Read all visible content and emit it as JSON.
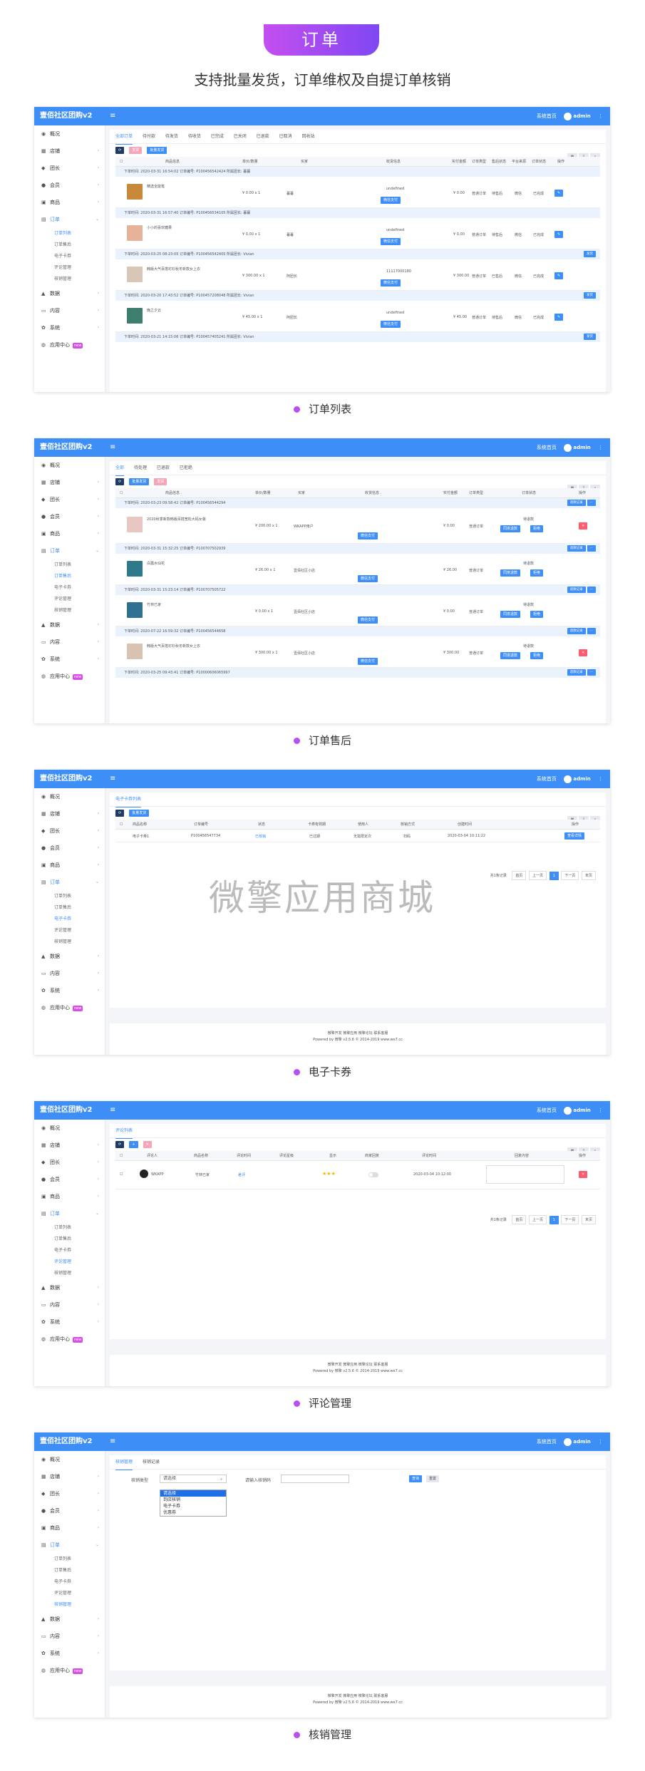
{
  "hero": {
    "badge": "订单",
    "subtitle": "支持批量发货，订单维权及自提订单核销"
  },
  "app": {
    "brand": "壹佰社区团购v2",
    "hamburger": "≡",
    "home_label": "系统首页",
    "user": "admin",
    "more": "⋮"
  },
  "sidebar": {
    "items": [
      {
        "icon": "◉",
        "label": "概况"
      },
      {
        "icon": "▦",
        "label": "店铺"
      },
      {
        "icon": "◆",
        "label": "团长"
      },
      {
        "icon": "●",
        "label": "会员"
      },
      {
        "icon": "▣",
        "label": "商品"
      },
      {
        "icon": "▤",
        "label": "订单"
      },
      {
        "icon": "▲",
        "label": "数据"
      },
      {
        "icon": "▭",
        "label": "内容"
      },
      {
        "icon": "✿",
        "label": "系统"
      },
      {
        "icon": "◍",
        "label": "应用中心",
        "tag": "new"
      }
    ],
    "sub": [
      "订单列表",
      "订单售后",
      "电子卡券",
      "评论管理",
      "核销管理"
    ]
  },
  "screens": {
    "orders": {
      "caption": "订单列表",
      "tabs": [
        "全部订单",
        "待付款",
        "待发货",
        "待收货",
        "已完成",
        "已关闭",
        "已退款",
        "已取消",
        "回收站"
      ],
      "buttons": [
        "发货",
        "批量发货"
      ],
      "headers": [
        "商品信息",
        "单价/数量",
        "买家",
        "收货信息",
        "实付金额",
        "订单类型",
        "售后状态",
        "平台来源",
        "订单状态",
        "操作"
      ],
      "groups": [
        {
          "head": "下单时间: 2020-03-31 16:54:02  订单编号: P100456542424  所属团长: 暮暮",
          "name": "精选全能笔",
          "price": "¥ 0.00 x 1",
          "buyer": "暮暮",
          "recv": "undefined",
          "amount": "¥ 0.00",
          "type": "普通订单",
          "after": "待售后",
          "src": "微信",
          "status": "已完成",
          "pay": "微信支付"
        },
        {
          "head": "下单时间: 2020-03-31 16:57:40  订单编号: P100456534105  所属团长: 暮暮",
          "name": "小小的喜欢糖果",
          "price": "¥ 0.00 x 1",
          "buyer": "暮暮",
          "recv": "undefined",
          "amount": "¥ 0.00",
          "type": "普通订单",
          "after": "待售后",
          "src": "微信",
          "status": "已完成",
          "pay": "微信支付"
        },
        {
          "head": "下单时间: 2020-03-25 08:23:05  订单编号: P100456542405  所属团长: Vivian",
          "name": "韩版大气百搭衬衫秋冬新款女上衣",
          "price": "¥ 300.00 x 1",
          "buyer": "阿团长",
          "recv": "11117000180",
          "amount": "¥ 300.00",
          "type": "普通订单",
          "after": "已售后",
          "src": "微信",
          "status": "已完成",
          "pay": "微信支付"
        },
        {
          "head": "下单时间: 2020-03-20 17:43:52  订单编号: P100457208048  所属团长: Vivian",
          "name": "晚之夕云",
          "price": "¥ 45.00 x 1",
          "buyer": "阿团长",
          "recv": "undefined",
          "amount": "¥ 45.00",
          "type": "普通订单",
          "after": "待售后",
          "src": "微信",
          "status": "已完成",
          "pay": "微信支付"
        }
      ],
      "last_head": "下单时间: 2020-03-21 14:15:06  订单编号: P100457405241  所属团长: Vivian"
    },
    "aftersale": {
      "caption": "订单售后",
      "tabs": [
        "全部",
        "待处理",
        "已退款",
        "已拒绝"
      ],
      "headers": [
        "商品信息",
        "单价/数量",
        "买家",
        "收货信息",
        "实付金额",
        "订单类型",
        "订单状态",
        "操作"
      ],
      "groups": [
        {
          "head": "下单时间: 2020-03-23 09:58:42  订单编号: P100456544294",
          "name": "2020秋季新款韩版百搭宽松大码女装",
          "price": "¥ 200.00 x 1",
          "buyer": "WKAPP用户",
          "amount": "¥ 0.00",
          "type": "普通订单",
          "status": "待退款"
        },
        {
          "head": "下单时间: 2020-03-31 15:32:25  订单编号: P100707502939",
          "name": "白露水仙花",
          "price": "¥ 26.00 x 1",
          "buyer": "壹佰社区小店",
          "amount": "¥ 26.00",
          "type": "普通订单",
          "status": "待退款"
        },
        {
          "head": "下单时间: 2020-03-31 15:23:14  订单编号: P100707505722",
          "name": "竹林已家",
          "price": "¥ 0.00 x 1",
          "buyer": "壹佰社区小店",
          "amount": "¥ 0.00",
          "type": "普通订单",
          "status": "待退款"
        },
        {
          "head": "下单时间: 2020-07-22 16:59:32  订单编号: P100456544658",
          "name": "韩版大气百搭衬衫秋冬新款女上衣",
          "price": "¥ 300.00 x 1",
          "buyer": "壹佰社区小店",
          "amount": "¥ 300.00",
          "type": "普通订单",
          "status": "待退款"
        }
      ],
      "last_head": "下单时间: 2020-03-25 09:43:41  订单编号: P10000606065997",
      "btn_log": "退款记录",
      "btn_agree": "同意退款",
      "btn_refuse": "拒绝"
    },
    "coupon": {
      "caption": "电子卡券",
      "tab": "电子卡券列表",
      "headers": [
        "商品名称",
        "订单编号",
        "状态",
        "卡券有效期",
        "使用人",
        "核销方式",
        "创建时间",
        "操作"
      ],
      "row": [
        "电子卡券1",
        "P100456547734",
        "已核销",
        "已过期",
        "无需限定次",
        "扫码",
        "2020-03-04 10:11:22",
        "查看详情"
      ],
      "watermark": "微擎应用商城",
      "pager": [
        "共1条记录",
        "首页",
        "上一页",
        "1",
        "下一页",
        "末页"
      ],
      "footer1": "微擎开发 微擎应用 微擎论坛 联系客服",
      "footer2": "Powered by 微擎 v2.5.6 © 2014-2019 www.we7.cc"
    },
    "comment": {
      "caption": "评论管理",
      "tab": "评论列表",
      "headers": [
        "评论人",
        "商品名称",
        "评论时间",
        "评论星级",
        "显示",
        "商家回复",
        "评论时间",
        "回复内容",
        "操作"
      ],
      "row": [
        "WKAPP",
        "竹林已家",
        "差评",
        "",
        "",
        "2020-03-04 10:12:00"
      ],
      "pager": [
        "共1条记录",
        "首页",
        "上一页",
        "1",
        "下一页",
        "末页"
      ],
      "footer1": "微擎开发 微擎应用 微擎论坛 联系客服",
      "footer2": "Powered by 微擎 v2.5.6 © 2014-2019 www.we7.cc"
    },
    "verify": {
      "caption": "核销管理",
      "tabs": [
        "核销管理",
        "核销记录"
      ],
      "label1": "核销类型",
      "label2": "请输入核销码",
      "select_value": "请选择",
      "options": [
        "请选择",
        "到店核销",
        "电子卡券",
        "优惠券"
      ],
      "btn_search": "查询",
      "btn_reset": "重置",
      "footer1": "微擎开发 微擎应用 微擎论坛 联系客服",
      "footer2": "Powered by 微擎 v2.5.6 © 2014-2019 www.we7.cc"
    }
  },
  "colors": {
    "primary": "#3e8ef7",
    "accent": "#b84ff0"
  }
}
